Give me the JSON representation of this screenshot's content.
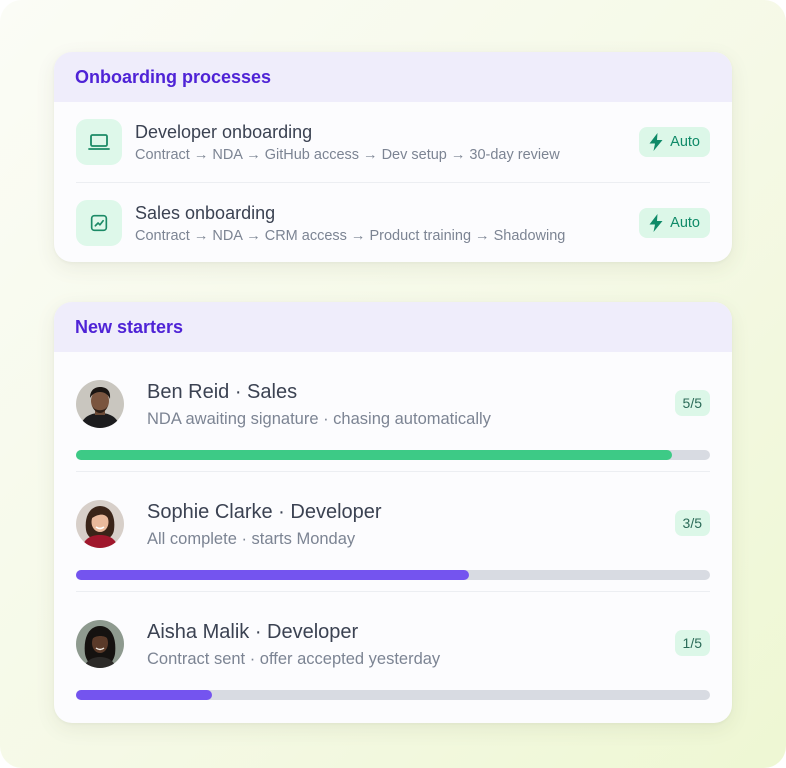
{
  "processes": {
    "title": "Onboarding processes",
    "items": [
      {
        "name": "Developer onboarding",
        "steps": "Contract → NDA → GitHub access → Dev setup → 30-day review",
        "icon": "laptop-icon",
        "badge": "Auto"
      },
      {
        "name": "Sales onboarding",
        "steps": "Contract → NDA → CRM access → Product training → Shadowing",
        "icon": "trend-chart-icon",
        "badge": "Auto"
      }
    ]
  },
  "starters": {
    "title": "New starters",
    "items": [
      {
        "name": "Ben Reid · Sales",
        "status": "NDA awaiting signature · chasing automatically",
        "count": "5/5",
        "progress": 0.94,
        "bar_color": "#3dca86"
      },
      {
        "name": "Sophie Clarke · Developer",
        "status": "All complete · starts Monday",
        "count": "3/5",
        "progress": 0.62,
        "bar_color": "#7454ef"
      },
      {
        "name": "Aisha Malik · Developer",
        "status": "Contract sent · offer accepted yesterday",
        "count": "1/5",
        "progress": 0.215,
        "bar_color": "#7454ef"
      }
    ]
  },
  "colors": {
    "accent": "#4f23d6",
    "success": "#0f8a68",
    "header_bg": "#efedfb"
  }
}
